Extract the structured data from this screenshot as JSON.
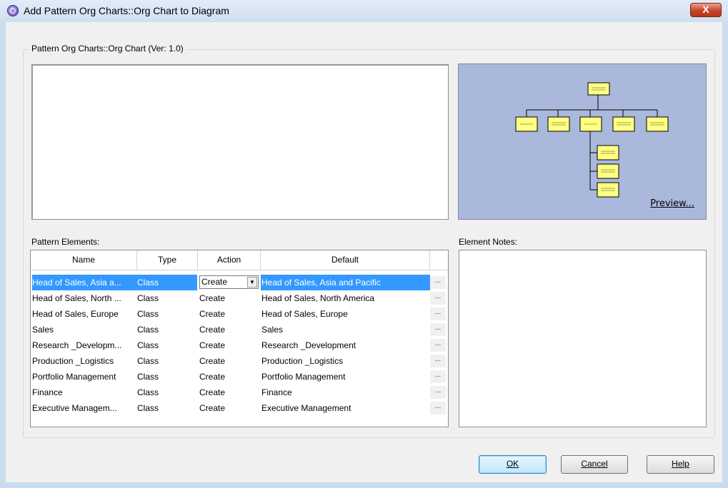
{
  "window": {
    "title": "Add Pattern Org Charts::Org Chart to Diagram",
    "close_label": "X"
  },
  "group": {
    "label": "Pattern Org Charts::Org Chart (Ver: 1.0)"
  },
  "preview": {
    "link_label": "Preview...",
    "background": "#aab8db",
    "box_color": "#ffff80"
  },
  "elements_label": "Pattern Elements:",
  "notes_label": "Element Notes:",
  "table": {
    "columns": [
      "Name",
      "Type",
      "Action",
      "Default"
    ],
    "more_button": "...",
    "rows": [
      {
        "name": "Head of Sales, Asia a...",
        "type": "Class",
        "action": "Create",
        "default": "Head of Sales, Asia and Pacific",
        "selected": true
      },
      {
        "name": "Head of Sales, North ...",
        "type": "Class",
        "action": "Create",
        "default": "Head of Sales, North America",
        "selected": false
      },
      {
        "name": "Head of Sales, Europe",
        "type": "Class",
        "action": "Create",
        "default": "Head of Sales, Europe",
        "selected": false
      },
      {
        "name": "Sales",
        "type": "Class",
        "action": "Create",
        "default": "Sales",
        "selected": false
      },
      {
        "name": "Research _Developm...",
        "type": "Class",
        "action": "Create",
        "default": "Research _Development",
        "selected": false
      },
      {
        "name": "Production _Logistics",
        "type": "Class",
        "action": "Create",
        "default": "Production _Logistics",
        "selected": false
      },
      {
        "name": "Portfolio Management",
        "type": "Class",
        "action": "Create",
        "default": "Portfolio Management",
        "selected": false
      },
      {
        "name": "Finance",
        "type": "Class",
        "action": "Create",
        "default": "Finance",
        "selected": false
      },
      {
        "name": "Executive Managem...",
        "type": "Class",
        "action": "Create",
        "default": "Executive Management",
        "selected": false
      }
    ]
  },
  "buttons": {
    "ok": "OK",
    "cancel": "Cancel",
    "help": "Help"
  }
}
